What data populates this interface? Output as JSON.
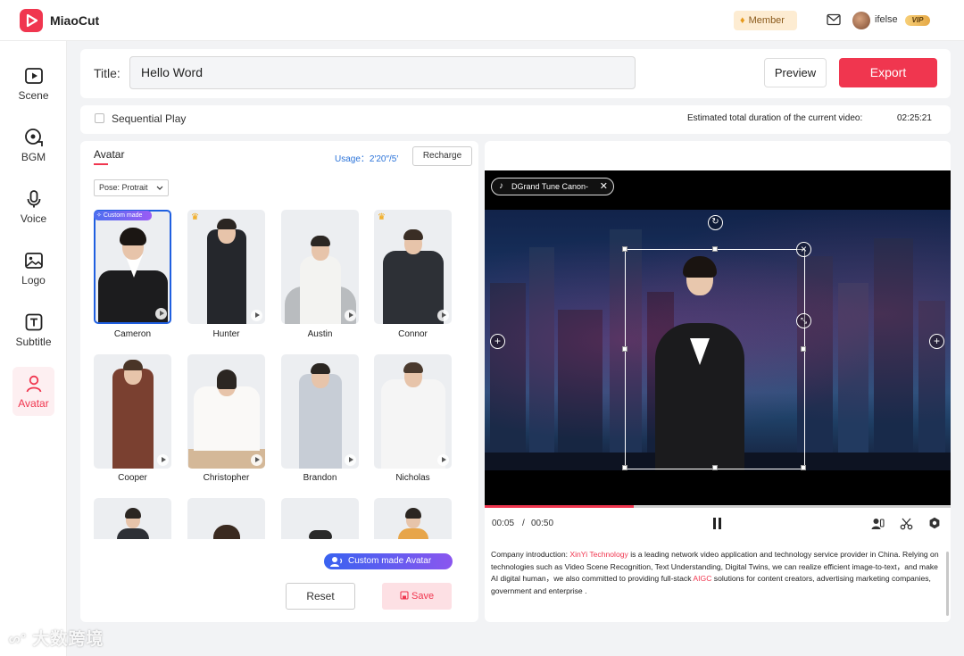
{
  "app": {
    "name": "MiaoCut"
  },
  "header": {
    "member_label": "Member",
    "username": "ifelse",
    "vip_label": "VIP"
  },
  "sidebar": {
    "items": [
      {
        "label": "Scene",
        "icon": "play-square-icon"
      },
      {
        "label": "BGM",
        "icon": "music-disc-icon"
      },
      {
        "label": "Voice",
        "icon": "microphone-icon"
      },
      {
        "label": "Logo",
        "icon": "image-icon"
      },
      {
        "label": "Subtitle",
        "icon": "text-box-icon"
      },
      {
        "label": "Avatar",
        "icon": "person-icon",
        "active": true
      }
    ]
  },
  "title_bar": {
    "label": "Title:",
    "value": "Hello Word",
    "preview_label": "Preview",
    "export_label": "Export"
  },
  "sequence": {
    "label": "Sequential Play",
    "checked": false,
    "duration_label": "Estimated total duration of the current video:",
    "duration_value": "02:25:21"
  },
  "avatar_panel": {
    "tab_label": "Avatar",
    "usage_label": "Usage：2′20″/5′",
    "recharge_label": "Recharge",
    "pose_label": "Pose:  Protrait",
    "custom_badge": "Custom made",
    "avatars": [
      {
        "name": "Cameron",
        "selected": true,
        "custom": true,
        "premium": false
      },
      {
        "name": "Hunter",
        "premium": true
      },
      {
        "name": "Austin",
        "premium": false
      },
      {
        "name": "Connor",
        "premium": true
      },
      {
        "name": "Cooper",
        "premium": false
      },
      {
        "name": "Christopher",
        "premium": false
      },
      {
        "name": "Brandon",
        "premium": false
      },
      {
        "name": "Nicholas",
        "premium": false
      }
    ],
    "custom_avatar_label": "Custom made Avatar",
    "reset_label": "Reset",
    "save_label": "Save"
  },
  "preview": {
    "music_chip": "DGrand Tune Canon-",
    "progress": 0.32,
    "time_current": "00:05",
    "time_separator": "/",
    "time_total": "00:50",
    "script": {
      "t1": "Company introduction: ",
      "h1": "XinYi Technology",
      "t2": " is a leading network video application and technology service provider in China. Relying on technologies such as Video Scene Recognition, Text Understanding, Digital Twins, we can realize efficient image-to-text，and make AI digital human，we also committed to providing full-stack ",
      "h2": "AIGC",
      "t3": " solutions for content creators, advertising marketing companies,  government and enterprise ."
    }
  },
  "watermark": "大数跨境",
  "colors": {
    "accent": "#f0364f",
    "link": "#2b73d9",
    "member_bg": "#fdecd2"
  }
}
